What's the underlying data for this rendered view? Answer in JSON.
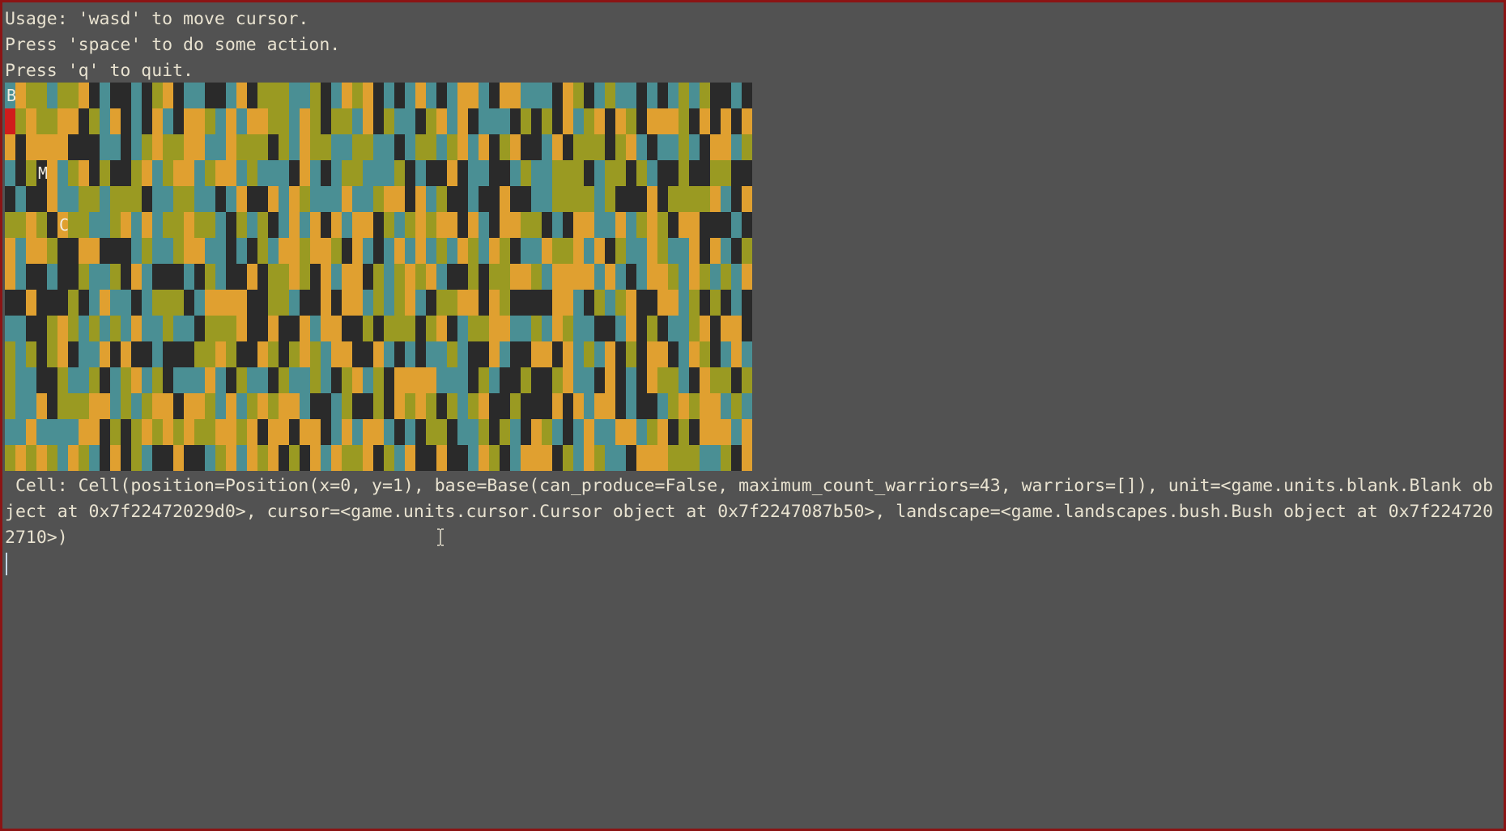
{
  "usage_lines": [
    "Usage: 'wasd' to move cursor.",
    "Press 'space' to do some action.",
    "Press 'q' to quit."
  ],
  "cell_info": [
    " Cell: Cell(position=Position(x=0, y=1), base=Base(can_produce=False, maximum_count_warriors=43, warriors=[]), unit=<game.units.blank.Blank ob",
    "ject at 0x7f22472029d0>, cursor=<game.units.cursor.Cursor object at 0x7f2247087b50>, landscape=<game.landscapes.bush.Bush object at 0x7f224720",
    "2710>)"
  ],
  "board": {
    "cols": 71,
    "rows": 15,
    "palette": {
      "dark": "#2a2a2a",
      "teal": "#4a8f94",
      "orange": "#e0a030",
      "olive": "#9a9a22",
      "cursor": "#d01c1c"
    },
    "markers": [
      {
        "glyph": "B",
        "col": 0,
        "row": 0
      },
      {
        "glyph": "M",
        "col": 3,
        "row": 3
      },
      {
        "glyph": "C",
        "col": 5,
        "row": 5
      }
    ],
    "cursor_cell": {
      "col": 0,
      "row": 1
    }
  },
  "colors": {
    "background": "#525252",
    "frame": "#8b1414",
    "text": "#e8e2d0"
  }
}
